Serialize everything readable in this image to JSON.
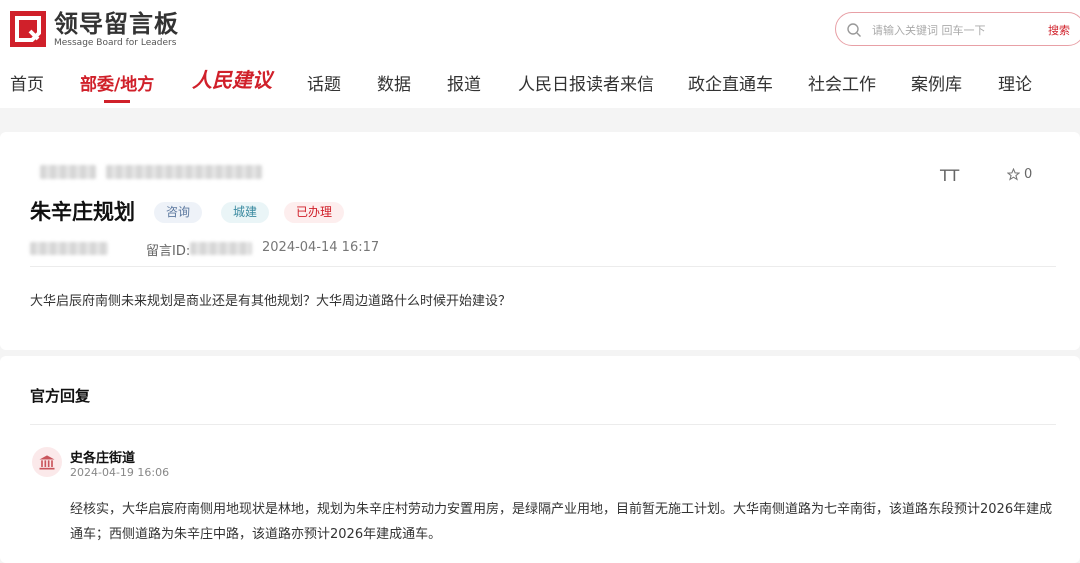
{
  "header": {
    "logo_title": "领导留言板",
    "logo_subtitle": "Message Board for Leaders",
    "search_placeholder": "请输入关键词 回车一下",
    "search_button": "搜索"
  },
  "nav": {
    "items": [
      "首页",
      "部委/地方",
      "话题",
      "数据",
      "报道",
      "人民日报读者来信",
      "政企直通车",
      "社会工作",
      "案例库",
      "理论"
    ],
    "rmjy_label": "人民建议",
    "active_index": 1
  },
  "message": {
    "title": "朱辛庄规划",
    "tags": [
      "咨询",
      "城建",
      "已办理"
    ],
    "id_label": "留言ID:",
    "date": "2024-04-14 16:17",
    "body": "大华启辰府南侧未来规划是商业还是有其他规划？大华周边道路什么时候开始建设？",
    "font_size_icon_label": "TT",
    "fav_count": "0"
  },
  "reply": {
    "heading": "官方回复",
    "org": "史各庄街道",
    "date": "2024-04-19 16:06",
    "body": "经核实，大华启宸府南侧用地现状是林地，规划为朱辛庄村劳动力安置用房，是绿隔产业用地，目前暂无施工计划。大华南侧道路为七辛南街，该道路东段预计2026年建成通车；西侧道路为朱辛庄中路，该道路亦预计2026年建成通车。"
  },
  "colors": {
    "brand_red": "#d0202a",
    "background": "#f4f4f4"
  }
}
